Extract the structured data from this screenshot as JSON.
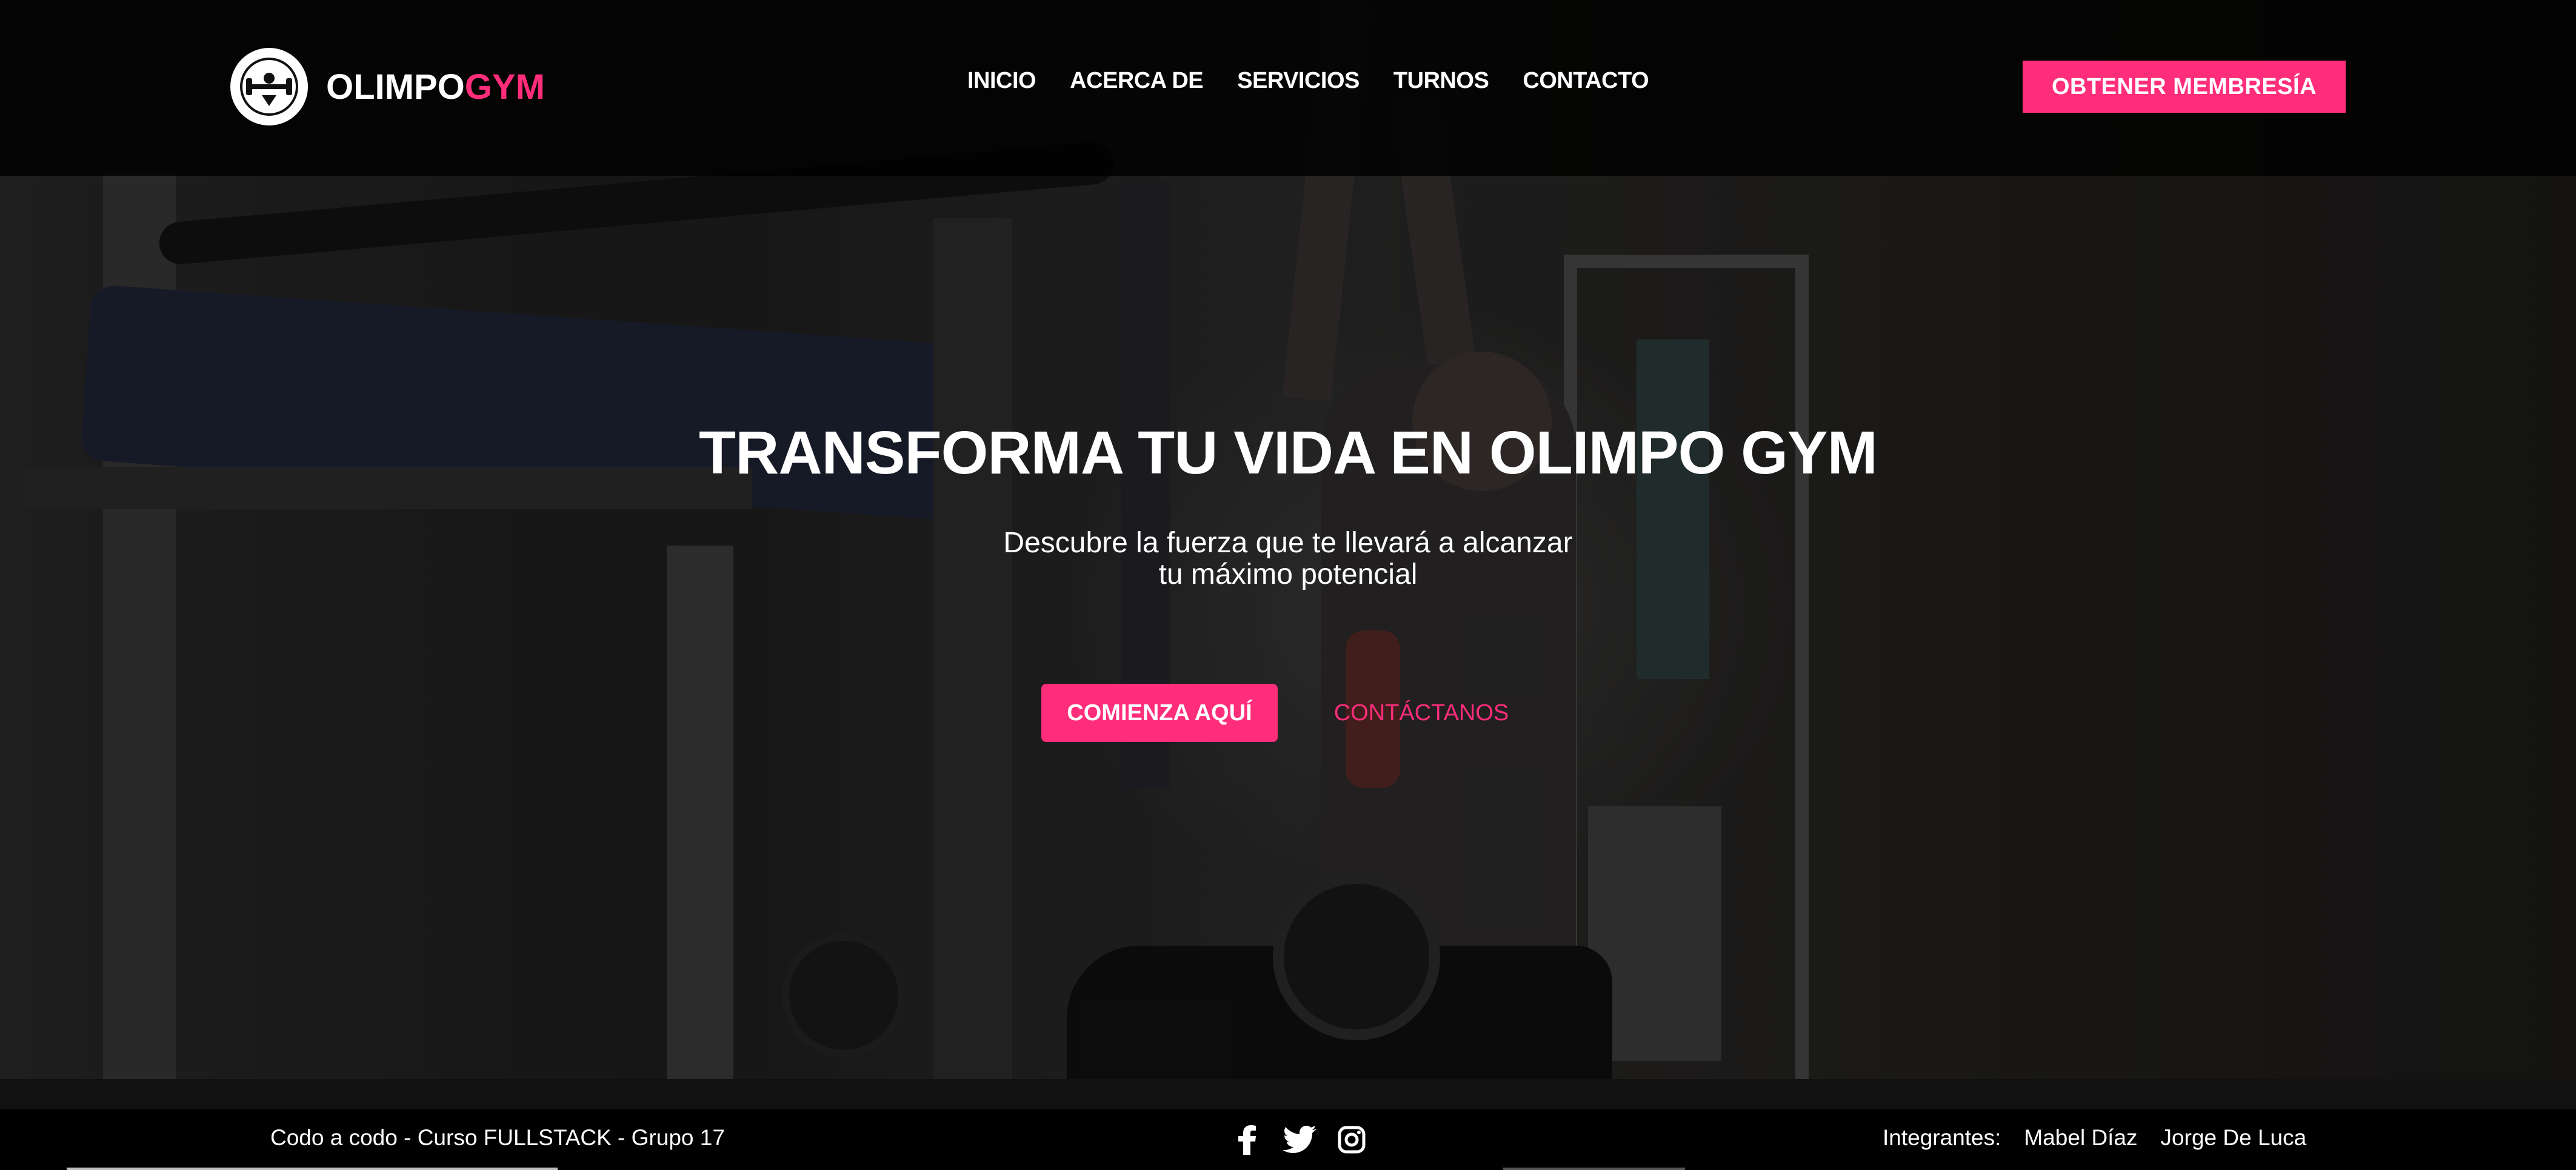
{
  "header": {
    "brand_part1": "OLIMPO",
    "brand_part2": "GYM",
    "logo_icon": "kettlebell-logo-icon",
    "nav": [
      {
        "label": "INICIO"
      },
      {
        "label": "ACERCA DE"
      },
      {
        "label": "SERVICIOS"
      },
      {
        "label": "TURNOS"
      },
      {
        "label": "CONTACTO"
      }
    ],
    "cta_label": "OBTENER MEMBRESÍA"
  },
  "hero": {
    "title": "TRANSFORMA TU VIDA EN OLIMPO GYM",
    "subtitle_line1": "Descubre la fuerza que te llevará a alcanzar",
    "subtitle_line2": "tu máximo potencial",
    "primary_button": "COMIENZA AQUÍ",
    "secondary_link": "CONTÁCTANOS"
  },
  "footer": {
    "credit": "Codo a codo - Curso FULLSTACK - Grupo 17",
    "social_icons": [
      "facebook-icon",
      "twitter-icon",
      "instagram-icon"
    ],
    "team_label": "Integrantes:",
    "members": [
      "Mabel Díaz",
      "Jorge De Luca"
    ]
  },
  "colors": {
    "accent": "#ff2d7a",
    "header_bg": "#000000",
    "text": "#ffffff"
  }
}
